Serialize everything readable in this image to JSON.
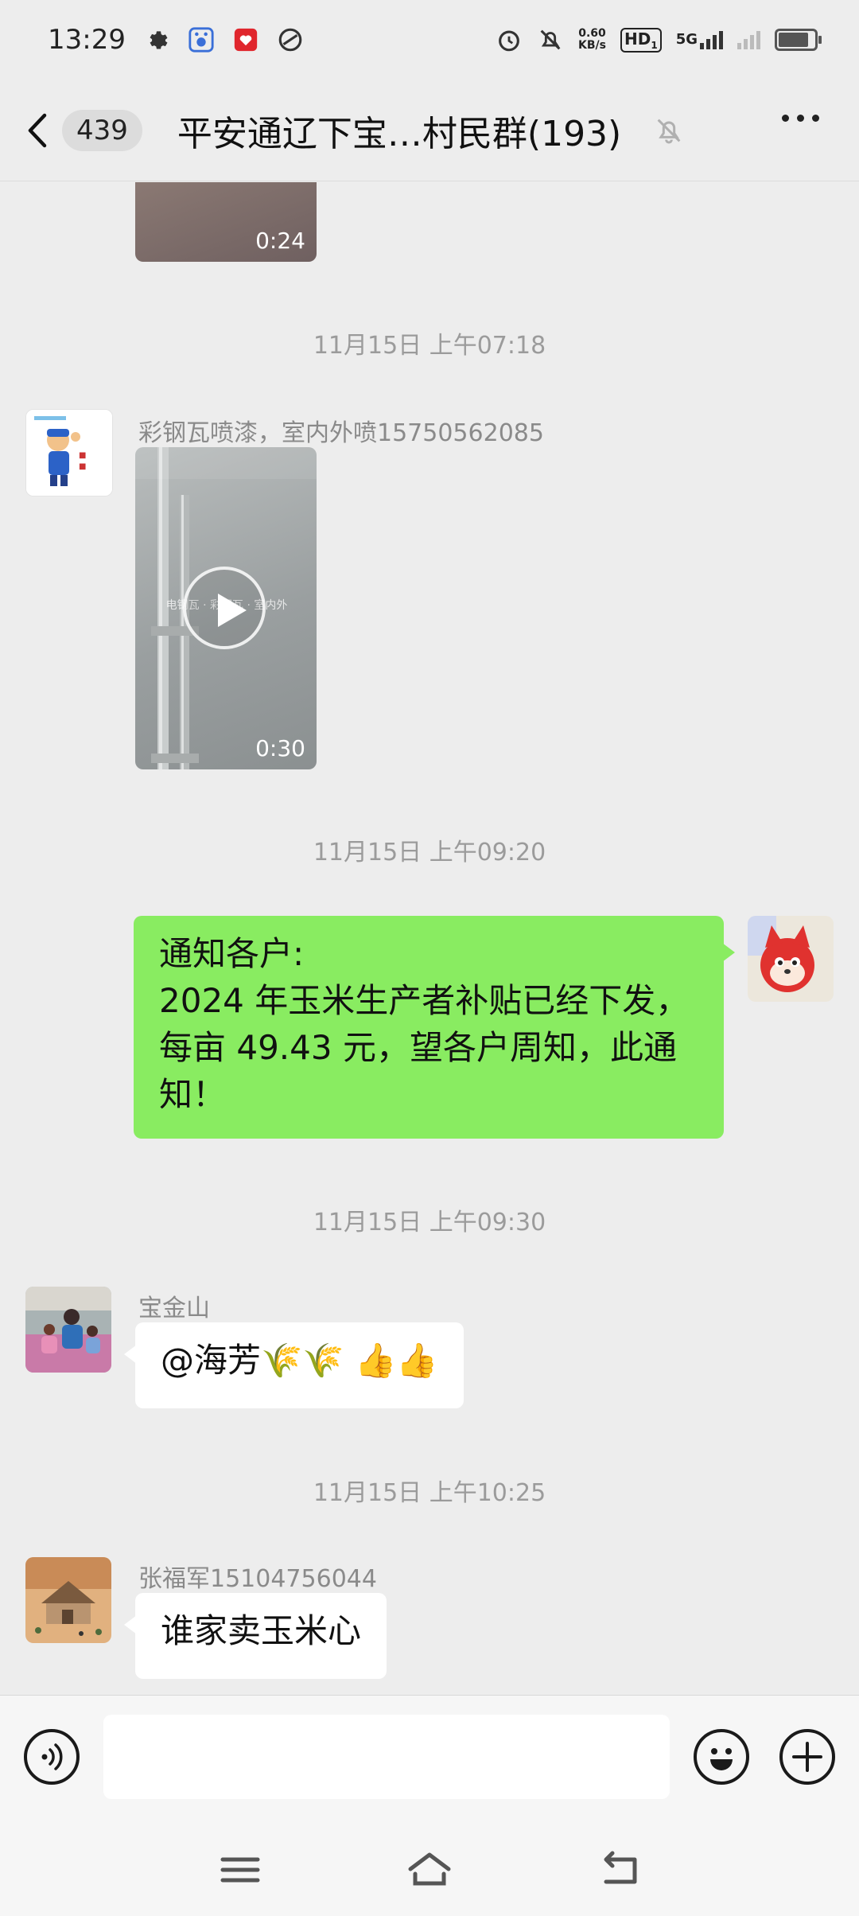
{
  "status_bar": {
    "time": "13:29",
    "net_speed_value": "0.60",
    "net_speed_unit": "KB/s",
    "hd_label": "HD",
    "hd_sub": "1",
    "network": "5G",
    "battery_level": 0.85
  },
  "header": {
    "unread_count": "439",
    "title": "平安通辽下宝…村民群(193)"
  },
  "messages": [
    {
      "type": "video",
      "duration": "0:24"
    },
    {
      "type": "timestamp",
      "text": "11月15日 上午07:18"
    },
    {
      "type": "video",
      "sender": "彩钢瓦喷漆，室内外喷15750562085",
      "duration": "0:30"
    },
    {
      "type": "timestamp",
      "text": "11月15日 上午09:20"
    },
    {
      "type": "text",
      "side": "right",
      "lines": [
        "通知各户:",
        "2024 年玉米生产者补贴已经下发，",
        "每亩 49.43 元，望各户周知，此通",
        "知！"
      ]
    },
    {
      "type": "timestamp",
      "text": "11月15日 上午09:30"
    },
    {
      "type": "text",
      "side": "left",
      "sender": "宝金山",
      "text": "@海芳🌾🌾 👍👍"
    },
    {
      "type": "timestamp",
      "text": "11月15日 上午10:25"
    },
    {
      "type": "text",
      "side": "left",
      "sender": "张福军15104756044",
      "text": "谁家卖玉米心"
    }
  ],
  "input": {
    "placeholder": ""
  },
  "colors": {
    "background": "#ededed",
    "bubble_self": "#89ec61",
    "bubble_other": "#ffffff",
    "timestamp": "#9b9b9b"
  }
}
